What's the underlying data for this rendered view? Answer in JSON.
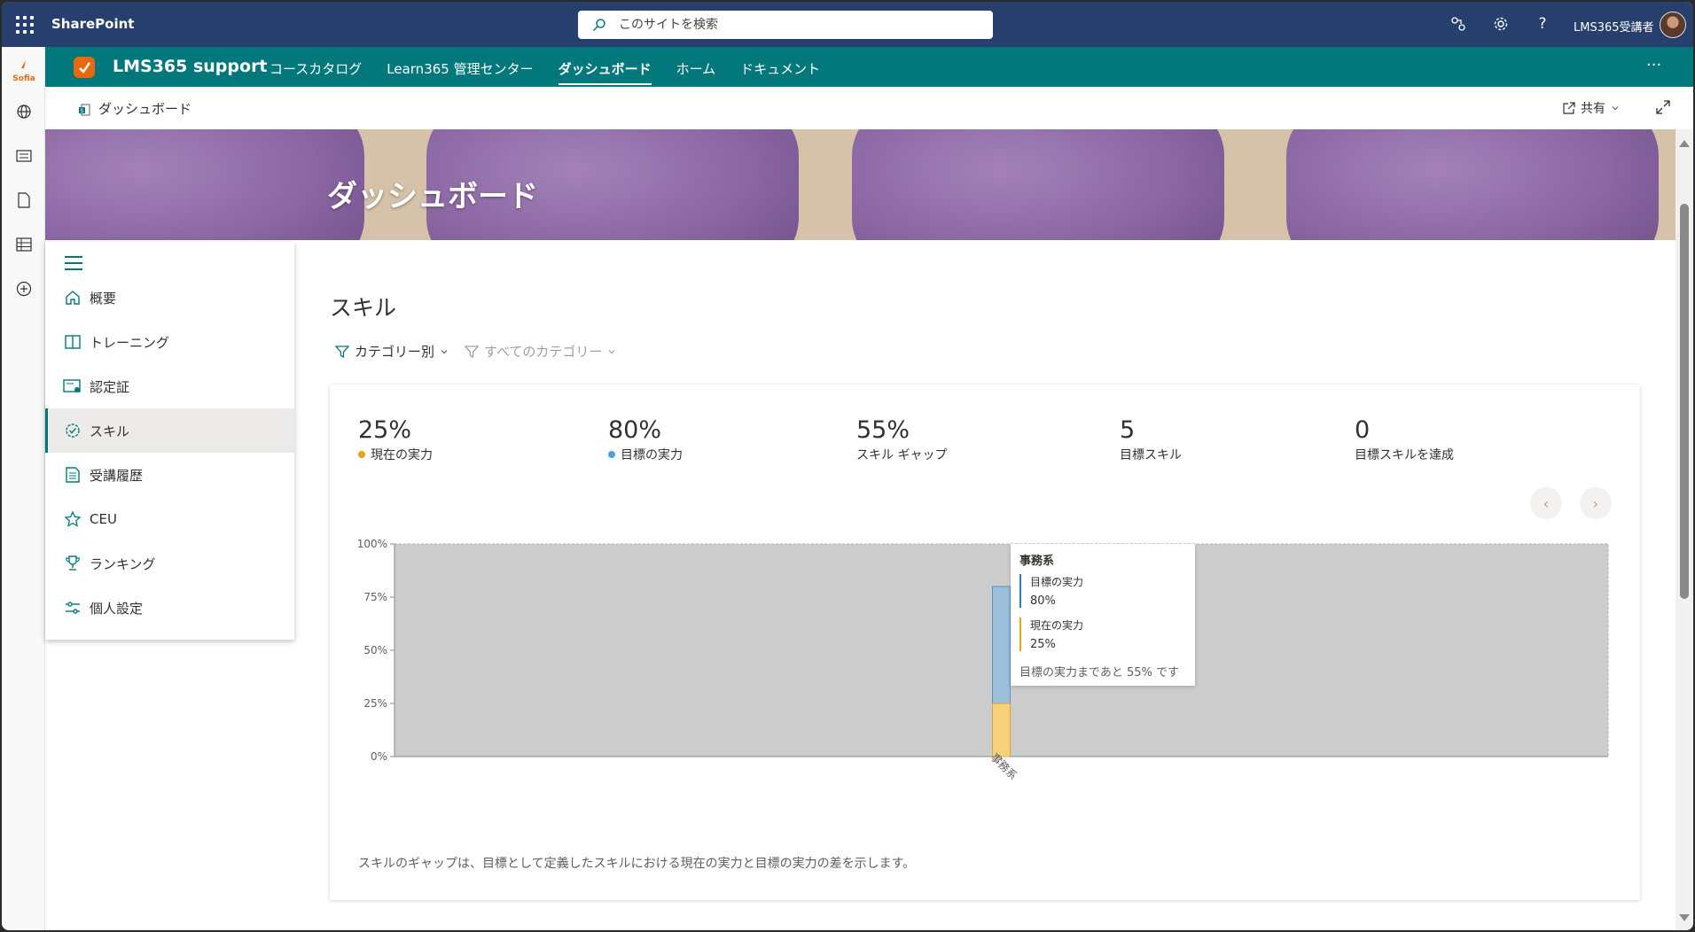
{
  "suite": {
    "brand": "SharePoint",
    "search_placeholder": "このサイトを検索",
    "username": "LMS365受講者"
  },
  "site": {
    "name": "LMS365 support",
    "nav": [
      {
        "label": "コースカタログ",
        "active": false
      },
      {
        "label": "Learn365 管理センター",
        "active": false
      },
      {
        "label": "ダッシュボード",
        "active": true
      },
      {
        "label": "ホーム",
        "active": false
      },
      {
        "label": "ドキュメント",
        "active": false
      }
    ],
    "more": "···"
  },
  "command": {
    "breadcrumb": "ダッシュボード",
    "share": "共有"
  },
  "appbar": {
    "logo_text": "Sofia"
  },
  "hero": {
    "title": "ダッシュボード"
  },
  "sidenav": {
    "items": [
      {
        "label": "概要",
        "icon": "home-icon"
      },
      {
        "label": "トレーニング",
        "icon": "book-icon"
      },
      {
        "label": "認定証",
        "icon": "certificate-icon"
      },
      {
        "label": "スキル",
        "icon": "skill-icon",
        "selected": true
      },
      {
        "label": "受講履歴",
        "icon": "history-icon"
      },
      {
        "label": "CEU",
        "icon": "star-icon"
      },
      {
        "label": "ランキング",
        "icon": "trophy-icon"
      },
      {
        "label": "個人設定",
        "icon": "settings-sliders-icon"
      }
    ]
  },
  "main": {
    "title": "スキル",
    "filter_category": "カテゴリー別",
    "filter_all": "すべてのカテゴリー",
    "stats": [
      {
        "value": "25%",
        "label": "現在の実力",
        "dot": "#e8a317"
      },
      {
        "value": "80%",
        "label": "目標の実力",
        "dot": "#4aa3df"
      },
      {
        "value": "55%",
        "label": "スキル ギャップ",
        "dot": ""
      },
      {
        "value": "5",
        "label": "目標スキル",
        "dot": ""
      },
      {
        "value": "0",
        "label": "目標スキルを達成",
        "dot": ""
      }
    ],
    "footnote": "スキルのギャップは、目標として定義したスキルにおける現在の実力と目標の実力の差を示します。"
  },
  "chart_data": {
    "type": "bar",
    "categories": [
      "事務系"
    ],
    "series": [
      {
        "name": "現在の実力",
        "values": [
          25
        ],
        "color": "#f5d27a"
      },
      {
        "name": "目標の実力",
        "values": [
          80
        ],
        "color": "#9cbfdc"
      }
    ],
    "yticks": [
      "0%",
      "25%",
      "50%",
      "75%",
      "100%"
    ],
    "ylim": [
      0,
      100
    ],
    "plot_bg": "#cccccc",
    "tooltip": {
      "title": "事務系",
      "target_label": "目標の実力",
      "target_value": "80%",
      "current_label": "現在の実力",
      "current_value": "25%",
      "message": "目標の実力まであと 55% です"
    }
  }
}
